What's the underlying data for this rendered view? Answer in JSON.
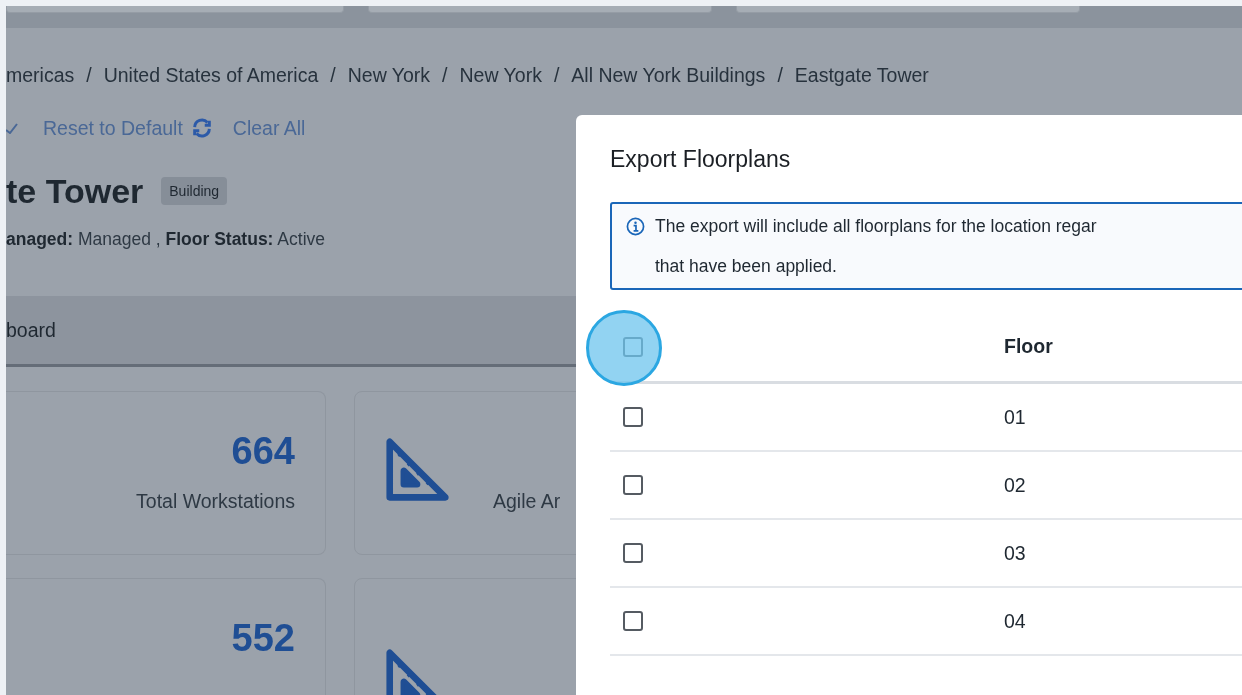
{
  "breadcrumb": {
    "separator": "/",
    "items": [
      "mericas",
      "United States of America",
      "New York",
      "New York",
      "All New York Buildings",
      "Eastgate Tower"
    ]
  },
  "actions": [
    {
      "label": "Reset to Default",
      "kind": "reset"
    },
    {
      "label": "Clear All",
      "kind": "plain"
    }
  ],
  "header": {
    "title": "te Tower",
    "badge": "Building",
    "meta": "**anaged:** Managed , **Floor Status:** Active"
  },
  "tab": {
    "label": "board"
  },
  "cards": [
    {
      "value": "664",
      "label": "Total Workstations",
      "kind": "number"
    },
    {
      "label": "Agile Ar",
      "kind": "icon"
    },
    {
      "value": "552",
      "kind": "number"
    },
    {
      "kind": "icon"
    }
  ],
  "modal": {
    "title": "Export Floorplans",
    "info": "The export will include all floorplans for the location regar\nthat have been applied.",
    "table": {
      "header": {
        "checked": false,
        "highlighted": true
      },
      "columns": [
        "Floor"
      ],
      "rows": [
        {
          "floor": "01",
          "checked": false
        },
        {
          "floor": "02",
          "checked": false
        },
        {
          "floor": "03",
          "checked": false
        },
        {
          "floor": "04",
          "checked": false
        }
      ]
    }
  }
}
